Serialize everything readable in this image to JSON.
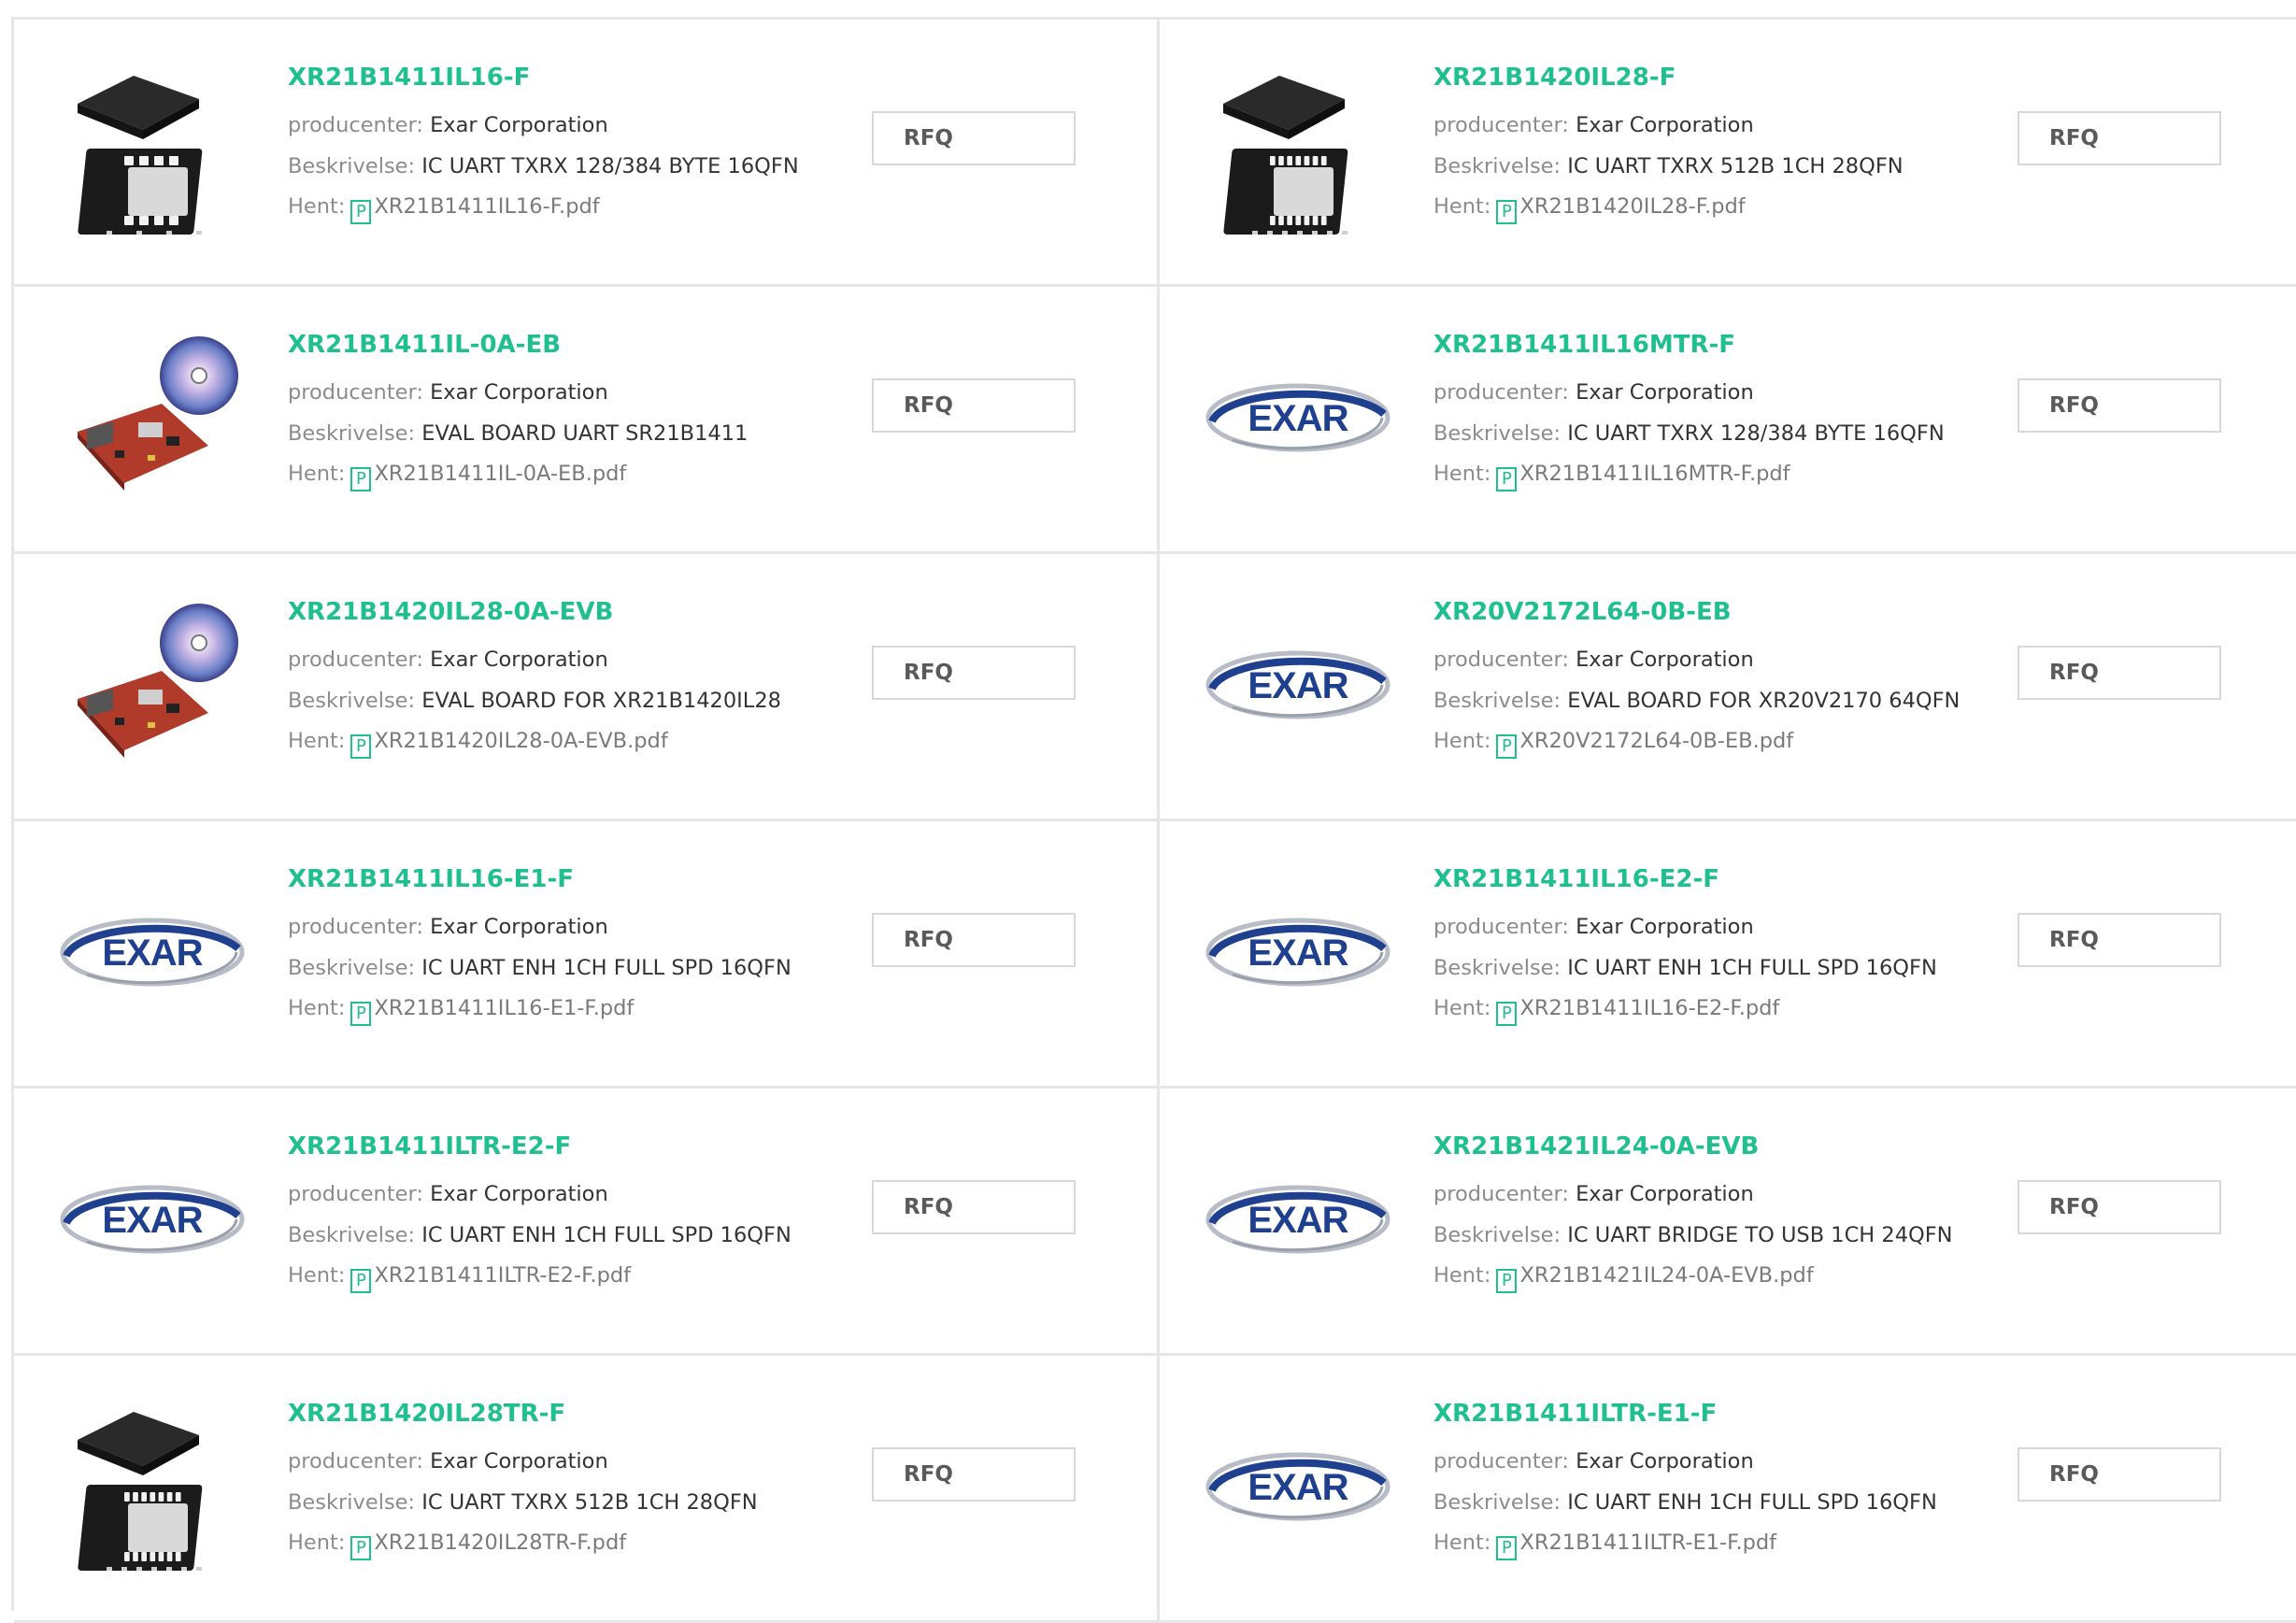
{
  "labels": {
    "manufacturer": "producenter:",
    "description": "Beskrivelse:",
    "download": "Hent:",
    "rfq": "RFQ",
    "pdf_glyph": "P"
  },
  "colors": {
    "accent": "#1fbf8f",
    "border": "#e6e6e6"
  },
  "products": [
    {
      "name": "XR21B1411IL16-F",
      "manufacturer": "Exar Corporation",
      "description": "IC UART TXRX 128/384 BYTE 16QFN",
      "pdf": "XR21B1411IL16-F.pdf",
      "image": "qfn16-chip-icon"
    },
    {
      "name": "XR21B1420IL28-F",
      "manufacturer": "Exar Corporation",
      "description": "IC UART TXRX 512B 1CH 28QFN",
      "pdf": "XR21B1420IL28-F.pdf",
      "image": "qfn28-chip-icon"
    },
    {
      "name": "XR21B1411IL-0A-EB",
      "manufacturer": "Exar Corporation",
      "description": "EVAL BOARD UART SR21B1411",
      "pdf": "XR21B1411IL-0A-EB.pdf",
      "image": "eval-board-disc-icon"
    },
    {
      "name": "XR21B1411IL16MTR-F",
      "manufacturer": "Exar Corporation",
      "description": "IC UART TXRX 128/384 BYTE 16QFN",
      "pdf": "XR21B1411IL16MTR-F.pdf",
      "image": "exar-logo"
    },
    {
      "name": "XR21B1420IL28-0A-EVB",
      "manufacturer": "Exar Corporation",
      "description": "EVAL BOARD FOR XR21B1420IL28",
      "pdf": "XR21B1420IL28-0A-EVB.pdf",
      "image": "eval-board-disc-icon"
    },
    {
      "name": "XR20V2172L64-0B-EB",
      "manufacturer": "Exar Corporation",
      "description": "EVAL BOARD FOR XR20V2170 64QFN",
      "pdf": "XR20V2172L64-0B-EB.pdf",
      "image": "exar-logo"
    },
    {
      "name": "XR21B1411IL16-E1-F",
      "manufacturer": "Exar Corporation",
      "description": "IC UART ENH 1CH FULL SPD 16QFN",
      "pdf": "XR21B1411IL16-E1-F.pdf",
      "image": "exar-logo"
    },
    {
      "name": "XR21B1411IL16-E2-F",
      "manufacturer": "Exar Corporation",
      "description": "IC UART ENH 1CH FULL SPD 16QFN",
      "pdf": "XR21B1411IL16-E2-F.pdf",
      "image": "exar-logo"
    },
    {
      "name": "XR21B1411ILTR-E2-F",
      "manufacturer": "Exar Corporation",
      "description": "IC UART ENH 1CH FULL SPD 16QFN",
      "pdf": "XR21B1411ILTR-E2-F.pdf",
      "image": "exar-logo"
    },
    {
      "name": "XR21B1421IL24-0A-EVB",
      "manufacturer": "Exar Corporation",
      "description": "IC UART BRIDGE TO USB 1CH 24QFN",
      "pdf": "XR21B1421IL24-0A-EVB.pdf",
      "image": "exar-logo"
    },
    {
      "name": "XR21B1420IL28TR-F",
      "manufacturer": "Exar Corporation",
      "description": "IC UART TXRX 512B 1CH 28QFN",
      "pdf": "XR21B1420IL28TR-F.pdf",
      "image": "qfn28-chip-icon"
    },
    {
      "name": "XR21B1411ILTR-E1-F",
      "manufacturer": "Exar Corporation",
      "description": "IC UART ENH 1CH FULL SPD 16QFN",
      "pdf": "XR21B1411ILTR-E1-F.pdf",
      "image": "exar-logo"
    }
  ],
  "logo_text": "EXAR"
}
